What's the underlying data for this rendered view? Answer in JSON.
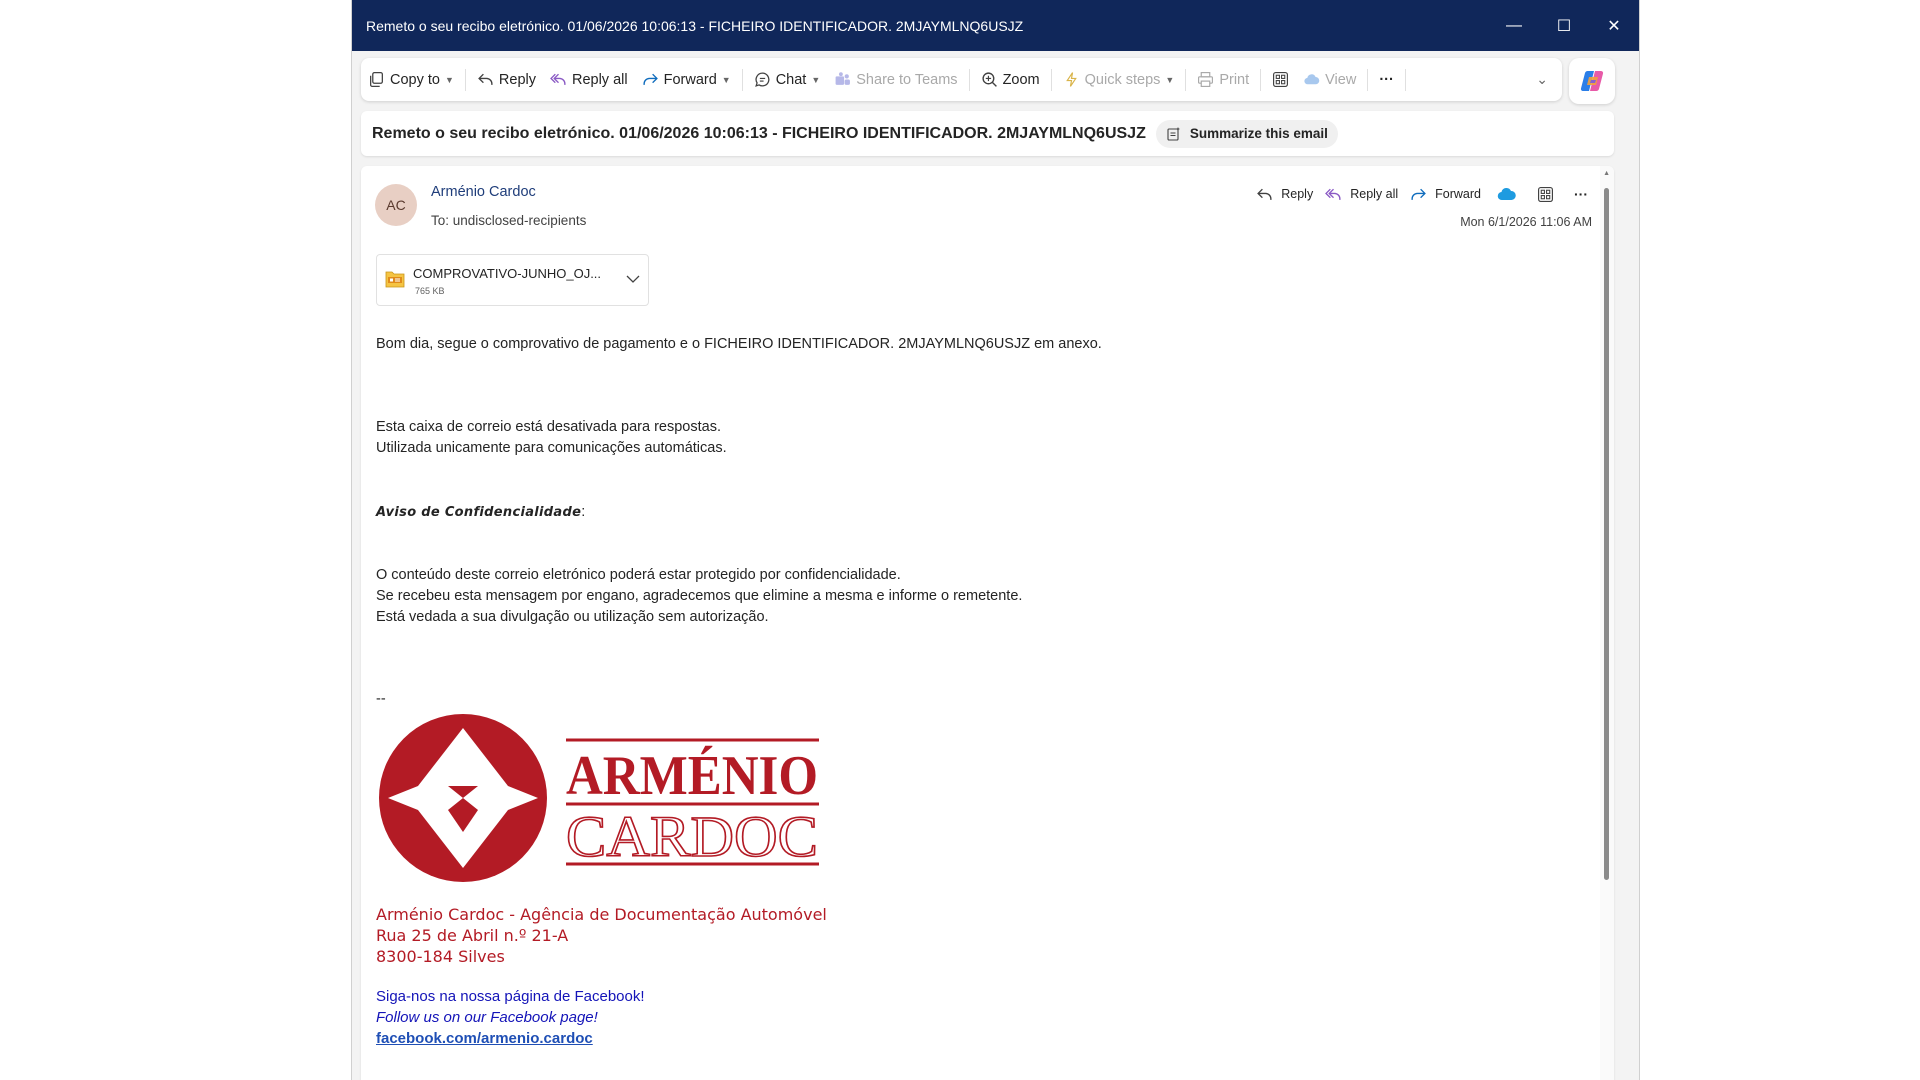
{
  "window": {
    "title": "Remeto o seu recibo eletrónico. 01/06/2026 10:06:13 - FICHEIRO IDENTIFICADOR. 2MJAYMLNQ6USJZ",
    "controls": {
      "minimize": "—",
      "maximize": "☐",
      "close": "✕"
    }
  },
  "toolbar": {
    "copy_to": "Copy to",
    "reply": "Reply",
    "reply_all": "Reply all",
    "forward": "Forward",
    "chat": "Chat",
    "share_to_teams": "Share to Teams",
    "zoom": "Zoom",
    "quick_steps": "Quick steps",
    "print": "Print",
    "view": "View",
    "more": "···",
    "expand": "⌄"
  },
  "subject": {
    "text": "Remeto o seu recibo eletrónico. 01/06/2026 10:06:13 - FICHEIRO IDENTIFICADOR. 2MJAYMLNQ6USJZ",
    "summarize": "Summarize this email"
  },
  "message": {
    "avatar_initials": "AC",
    "sender": "Arménio Cardoc",
    "to": "To:  undisclosed-recipients",
    "date": "Mon 6/1/2026 11:06 AM",
    "actions": {
      "reply": "Reply",
      "reply_all": "Reply all",
      "forward": "Forward",
      "more": "···"
    },
    "attachment": {
      "name": "COMPROVATIVO-JUNHO_OJ...",
      "size": "765 KB"
    },
    "body": {
      "greeting": "Bom dia, segue o comprovativo de pagamento e o FICHEIRO IDENTIFICADOR. 2MJAYMLNQ6USJZ em anexo.",
      "mailbox_1": "Esta caixa de correio está desativada para respostas.",
      "mailbox_2": "Utilizada unicamente para comunicações automáticas.",
      "conf_title": "Aviso de Confidencialidade",
      "conf_colon": ":",
      "conf_1": "O conteúdo deste correio eletrónico poderá estar protegido por confidencialidade.",
      "conf_2": "Se recebeu esta mensagem por engano, agradecemos que elimine a mesma e informe o remetente.",
      "conf_3": "Está vedada a sua divulgação ou utilização sem autorização.",
      "sig_sep": "--"
    },
    "logo": {
      "line1": "ARMÉNIO",
      "line2": "CARDOC",
      "color": "#b31b25"
    },
    "signature": {
      "company": "Arménio Cardoc - Agência de Documentação Automóvel",
      "street": "Rua 25 de Abril n.º 21-A",
      "city": "8300-184 Silves",
      "fb_pt": "Siga-nos na nossa página de Facebook!",
      "fb_en": "Follow us on our Facebook page!",
      "fb_link": "facebook.com/armenio.cardoc"
    }
  },
  "colors": {
    "titlebar": "#10275a",
    "accent": "#0f6cbd",
    "sender": "#1f3d7a",
    "signature_red": "#b31b25",
    "signature_blue": "#1414b8"
  }
}
